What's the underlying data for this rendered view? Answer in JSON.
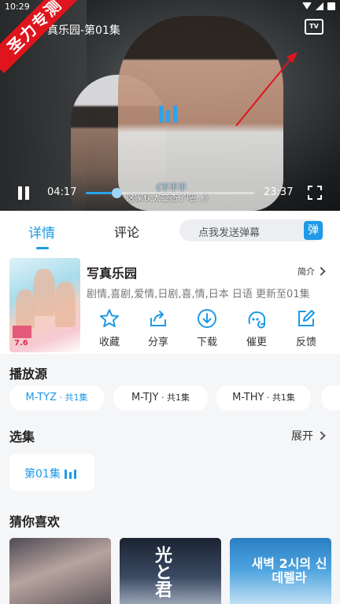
{
  "status_bar": {
    "time": "10:29"
  },
  "watermark": {
    "text": "圣力专测"
  },
  "player": {
    "title": "真乐园-第01集",
    "tv_label": "TV",
    "current_time": "04:17",
    "total_time": "23:37",
    "progress": 0.18,
    "subtitle_line1": "《不不不",
    "subtitle_line2": "这家伙太变态了吧...》"
  },
  "tabs": [
    {
      "label": "详情",
      "active": true
    },
    {
      "label": "评论",
      "active": false
    }
  ],
  "danmu": {
    "placeholder": "点我发送弹幕",
    "button": "弹"
  },
  "show": {
    "title": "写真乐园",
    "intro_label": "简介",
    "tags": "剧情,喜剧,爱情,日剧,喜,情,日本 日语 更新至01集",
    "poster_date": "7.6"
  },
  "actions": [
    {
      "label": "收藏",
      "icon": "star-icon"
    },
    {
      "label": "分享",
      "icon": "share-icon"
    },
    {
      "label": "下载",
      "icon": "download-icon"
    },
    {
      "label": "催更",
      "icon": "urge-icon"
    },
    {
      "label": "反馈",
      "icon": "edit-icon"
    }
  ],
  "sources": {
    "title": "播放源",
    "items": [
      {
        "name": "M-TYZ",
        "count": " · 共1集",
        "active": true
      },
      {
        "name": "M-TJY",
        "count": " · 共1集",
        "active": false
      },
      {
        "name": "M-THY",
        "count": " · 共1集",
        "active": false
      }
    ]
  },
  "episodes": {
    "title": "选集",
    "expand_label": "展开",
    "items": [
      {
        "label": "第01集",
        "playing": true
      }
    ]
  },
  "recommend": {
    "title": "猜你喜欢",
    "items": [
      {
        "text": ""
      },
      {
        "text": "光と君"
      },
      {
        "text": "새벽 2시의 신데렐라"
      }
    ]
  },
  "colors": {
    "accent": "#1e9ae6",
    "watermark": "#e0141c",
    "background": "#f5f6f8"
  }
}
